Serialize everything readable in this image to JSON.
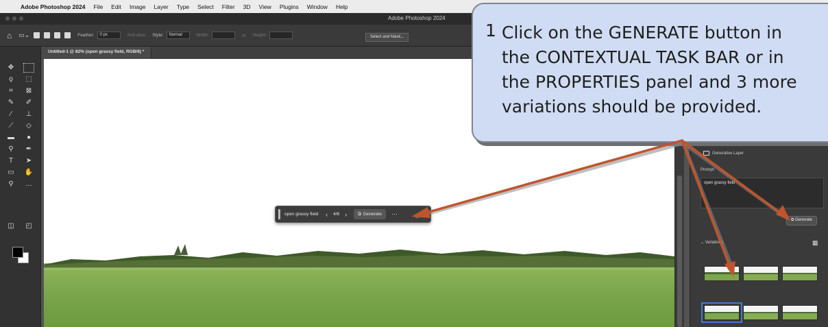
{
  "menubar": {
    "items": [
      "Adobe Photoshop 2024",
      "File",
      "Edit",
      "Image",
      "Layer",
      "Type",
      "Select",
      "Filter",
      "3D",
      "View",
      "Plugins",
      "Window",
      "Help"
    ]
  },
  "titlebar": {
    "title": "Adobe Photoshop 2024"
  },
  "options_bar": {
    "feather_label": "Feather:",
    "feather_value": "0 px",
    "antialias_label": "Anti-alias",
    "style_label": "Style:",
    "style_value": "Normal",
    "width_label": "Width:",
    "height_label": "Height:",
    "select_mask_label": "Select and Mask..."
  },
  "document_tab": {
    "label": "Untitled-1 @ 82% (open grassy field, RGB/8) *"
  },
  "contextual_task_bar": {
    "prompt": "open grassy field",
    "counter": "4/6",
    "generate_label": "Generate"
  },
  "properties_panel": {
    "layer_label": "Generative Layer",
    "prompt_label": "Prompt:",
    "prompt_value": "open grassy field",
    "generate_label": "Generate",
    "variations_label": "Variations"
  },
  "callout": {
    "number": "1",
    "text": "Click on the GENERATE button in\nthe CONTEXTUAL TASK BAR or in\nthe PROPERTIES panel and 3 more\nvariations should be provided."
  },
  "colors": {
    "callout_fill": "#cfdcf3",
    "arrow": "#c0542c",
    "selection": "#3f7bd5"
  }
}
